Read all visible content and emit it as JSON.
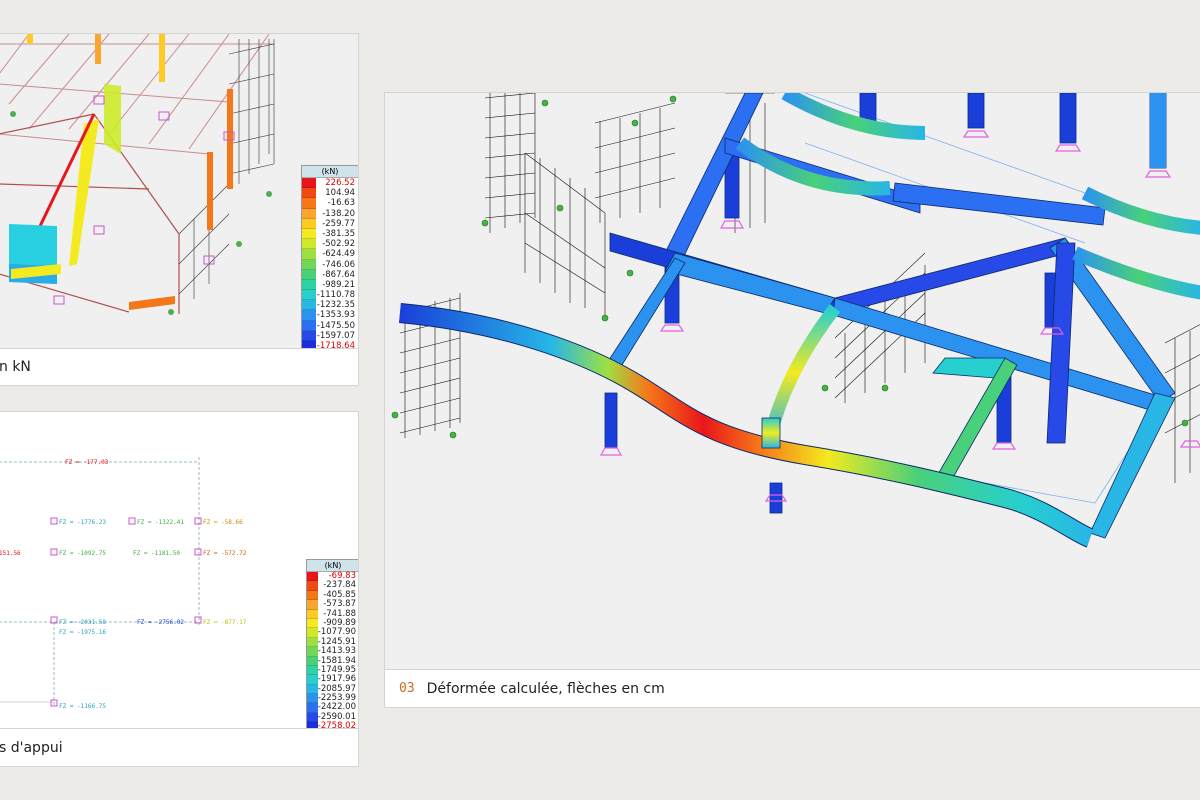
{
  "panels": [
    {
      "caption_text": "n kN",
      "legend": {
        "unit": "(kN)",
        "values": [
          "226.52",
          "104.94",
          "-16.63",
          "-138.20",
          "-259.77",
          "-381.35",
          "-502.92",
          "-624.49",
          "-746.06",
          "-867.64",
          "-989.21",
          "-1110.78",
          "-1232.35",
          "-1353.93",
          "-1475.50",
          "-1597.07",
          "-1718.64"
        ]
      }
    },
    {
      "caption_text": "s d'appui",
      "legend": {
        "unit": "(kN)",
        "values": [
          "-69.83",
          "-237.84",
          "-405.85",
          "-573.87",
          "-741.88",
          "-909.89",
          "-1077.90",
          "-1245.91",
          "-1413.93",
          "-1581.94",
          "-1749.95",
          "-1917.96",
          "-2085.97",
          "-2253.99",
          "-2422.00",
          "-2590.01",
          "-2758.02"
        ]
      },
      "labels": [
        "FZ = -1776.23",
        "FZ = -1322.41",
        "FZ = -58.66",
        "FZ = -1092.75",
        "FZ = -1181.50",
        "FZ = -572.72",
        "FZ = -2756.02",
        "FZ = -2031.58",
        "FZ = -1975.16",
        "FZ = -877.17",
        "FZ = -1166.75",
        "151.56",
        "FZ = -177.03"
      ]
    },
    {
      "number": "03",
      "caption_text": "Déformée calculée, flèches en cm"
    }
  ],
  "scale_colors": [
    "#e8161b",
    "#f04a10",
    "#f6761a",
    "#fba531",
    "#fdcb23",
    "#f3ea1f",
    "#cdea2a",
    "#9ee043",
    "#6fd759",
    "#49d07a",
    "#2ed2a4",
    "#27cfcf",
    "#27b6e6",
    "#2b93ef",
    "#2d6ff2",
    "#2649e8",
    "#1a2fd9"
  ]
}
